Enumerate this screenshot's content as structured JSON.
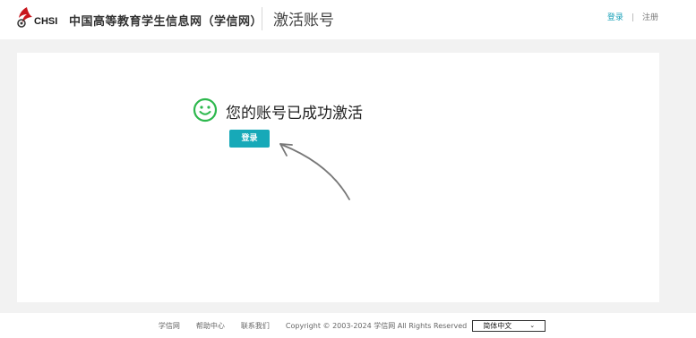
{
  "header": {
    "logo_text": "CHSI",
    "site_name": "中国高等教育学生信息网（学信网）",
    "page_title": "激活账号",
    "login_link": "登录",
    "separator": "|",
    "register_link": "注册"
  },
  "main": {
    "success_message": "您的账号已成功激活",
    "login_button": "登录"
  },
  "footer": {
    "links": [
      "学信网",
      "帮助中心",
      "联系我们"
    ],
    "copyright": "Copyright © 2003-2024 学信网 All Rights Reserved",
    "language": "简体中文"
  },
  "colors": {
    "accent": "#17a9b8",
    "success_green": "#2db84d",
    "logo_red": "#c8161d"
  }
}
